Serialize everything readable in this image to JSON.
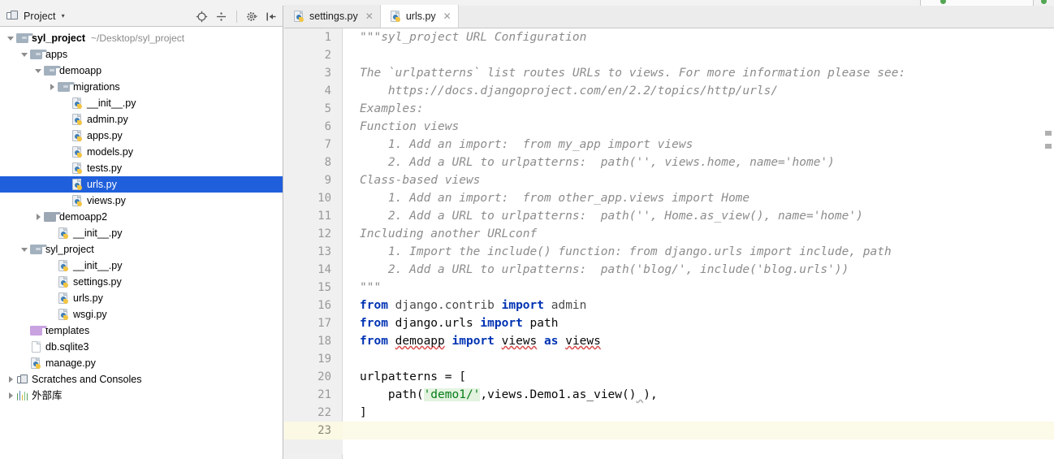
{
  "window": {
    "accent_selection": "#1f5fdb",
    "current_line_highlight": "#fcfae8"
  },
  "project_panel": {
    "title": "Project",
    "caret": "▾",
    "icons": [
      {
        "name": "locate-icon",
        "glyph": "⊕"
      },
      {
        "name": "collapse-all-icon",
        "glyph": "÷"
      },
      {
        "name": "settings-gear-icon",
        "glyph": "✼"
      },
      {
        "name": "hide-panel-icon",
        "glyph": "⇤"
      }
    ],
    "tree": [
      {
        "label": "syl_project",
        "hint": "~/Desktop/syl_project",
        "icon": "folder-module",
        "arrow": "down",
        "indent": 0,
        "bold": true,
        "selected": false
      },
      {
        "label": "apps",
        "hint": "",
        "icon": "folder-module",
        "arrow": "down",
        "indent": 1,
        "bold": false,
        "selected": false
      },
      {
        "label": "demoapp",
        "hint": "",
        "icon": "folder-module",
        "arrow": "down",
        "indent": 2,
        "bold": false,
        "selected": false
      },
      {
        "label": "migrations",
        "hint": "",
        "icon": "folder-module",
        "arrow": "right",
        "indent": 3,
        "bold": false,
        "selected": false
      },
      {
        "label": "__init__.py",
        "hint": "",
        "icon": "python-file",
        "arrow": "none",
        "indent": 4,
        "bold": false,
        "selected": false
      },
      {
        "label": "admin.py",
        "hint": "",
        "icon": "python-file",
        "arrow": "none",
        "indent": 4,
        "bold": false,
        "selected": false
      },
      {
        "label": "apps.py",
        "hint": "",
        "icon": "python-file",
        "arrow": "none",
        "indent": 4,
        "bold": false,
        "selected": false
      },
      {
        "label": "models.py",
        "hint": "",
        "icon": "python-file",
        "arrow": "none",
        "indent": 4,
        "bold": false,
        "selected": false
      },
      {
        "label": "tests.py",
        "hint": "",
        "icon": "python-file",
        "arrow": "none",
        "indent": 4,
        "bold": false,
        "selected": false
      },
      {
        "label": "urls.py",
        "hint": "",
        "icon": "python-file",
        "arrow": "none",
        "indent": 4,
        "bold": false,
        "selected": true
      },
      {
        "label": "views.py",
        "hint": "",
        "icon": "python-file",
        "arrow": "none",
        "indent": 4,
        "bold": false,
        "selected": false
      },
      {
        "label": "demoapp2",
        "hint": "",
        "icon": "folder-plain",
        "arrow": "right",
        "indent": 2,
        "bold": false,
        "selected": false
      },
      {
        "label": "__init__.py",
        "hint": "",
        "icon": "python-file",
        "arrow": "none",
        "indent": 3,
        "bold": false,
        "selected": false
      },
      {
        "label": "syl_project",
        "hint": "",
        "icon": "folder-module",
        "arrow": "down",
        "indent": 1,
        "bold": false,
        "selected": false
      },
      {
        "label": "__init__.py",
        "hint": "",
        "icon": "python-file",
        "arrow": "none",
        "indent": 3,
        "bold": false,
        "selected": false
      },
      {
        "label": "settings.py",
        "hint": "",
        "icon": "python-file",
        "arrow": "none",
        "indent": 3,
        "bold": false,
        "selected": false
      },
      {
        "label": "urls.py",
        "hint": "",
        "icon": "python-file",
        "arrow": "none",
        "indent": 3,
        "bold": false,
        "selected": false
      },
      {
        "label": "wsgi.py",
        "hint": "",
        "icon": "python-file",
        "arrow": "none",
        "indent": 3,
        "bold": false,
        "selected": false
      },
      {
        "label": "templates",
        "hint": "",
        "icon": "folder-purple",
        "arrow": "none",
        "indent": 1,
        "bold": false,
        "selected": false
      },
      {
        "label": "db.sqlite3",
        "hint": "",
        "icon": "document-file",
        "arrow": "none",
        "indent": 1,
        "bold": false,
        "selected": false
      },
      {
        "label": "manage.py",
        "hint": "",
        "icon": "python-file",
        "arrow": "none",
        "indent": 1,
        "bold": false,
        "selected": false
      },
      {
        "label": "Scratches and Consoles",
        "hint": "",
        "icon": "scratches",
        "arrow": "right",
        "indent": 0,
        "bold": false,
        "selected": false
      },
      {
        "label": "外部库",
        "hint": "",
        "icon": "external-libraries",
        "arrow": "right",
        "indent": 0,
        "bold": false,
        "selected": false
      }
    ]
  },
  "editor": {
    "tabs": [
      {
        "label": "settings.py",
        "icon": "python-file",
        "active": false,
        "close": "✕"
      },
      {
        "label": "urls.py",
        "icon": "python-file",
        "active": true,
        "close": "✕"
      }
    ],
    "current_line": 23,
    "lines": [
      {
        "n": "1",
        "text": "\"\"\"syl_project URL Configuration",
        "style": "doc"
      },
      {
        "n": "2",
        "text": "",
        "style": "doc"
      },
      {
        "n": "3",
        "text": "The `urlpatterns` list routes URLs to views. For more information please see:",
        "style": "doc"
      },
      {
        "n": "4",
        "text": "    https://docs.djangoproject.com/en/2.2/topics/http/urls/",
        "style": "doc"
      },
      {
        "n": "5",
        "text": "Examples:",
        "style": "doc"
      },
      {
        "n": "6",
        "text": "Function views",
        "style": "doc"
      },
      {
        "n": "7",
        "text": "    1. Add an import:  from my_app import views",
        "style": "doc"
      },
      {
        "n": "8",
        "text": "    2. Add a URL to urlpatterns:  path('', views.home, name='home')",
        "style": "doc"
      },
      {
        "n": "9",
        "text": "Class-based views",
        "style": "doc"
      },
      {
        "n": "10",
        "text": "    1. Add an import:  from other_app.views import Home",
        "style": "doc"
      },
      {
        "n": "11",
        "text": "    2. Add a URL to urlpatterns:  path('', Home.as_view(), name='home')",
        "style": "doc"
      },
      {
        "n": "12",
        "text": "Including another URLconf",
        "style": "doc"
      },
      {
        "n": "13",
        "text": "    1. Import the include() function: from django.urls import include, path",
        "style": "doc"
      },
      {
        "n": "14",
        "text": "    2. Add a URL to urlpatterns:  path('blog/', include('blog.urls'))",
        "style": "doc"
      },
      {
        "n": "15",
        "text": "\"\"\"",
        "style": "doc"
      },
      {
        "n": "16",
        "text": "from django.contrib import admin",
        "style": "code"
      },
      {
        "n": "17",
        "text": "from django.urls import path",
        "style": "code"
      },
      {
        "n": "18",
        "text": "from demoapp import views as views",
        "style": "code"
      },
      {
        "n": "19",
        "text": "",
        "style": "code"
      },
      {
        "n": "20",
        "text": "urlpatterns = [",
        "style": "code"
      },
      {
        "n": "21",
        "text": "    path('demo1/',views.Demo1.as_view() ),",
        "style": "code"
      },
      {
        "n": "22",
        "text": "]",
        "style": "code"
      },
      {
        "n": "23",
        "text": "",
        "style": "code"
      }
    ]
  }
}
